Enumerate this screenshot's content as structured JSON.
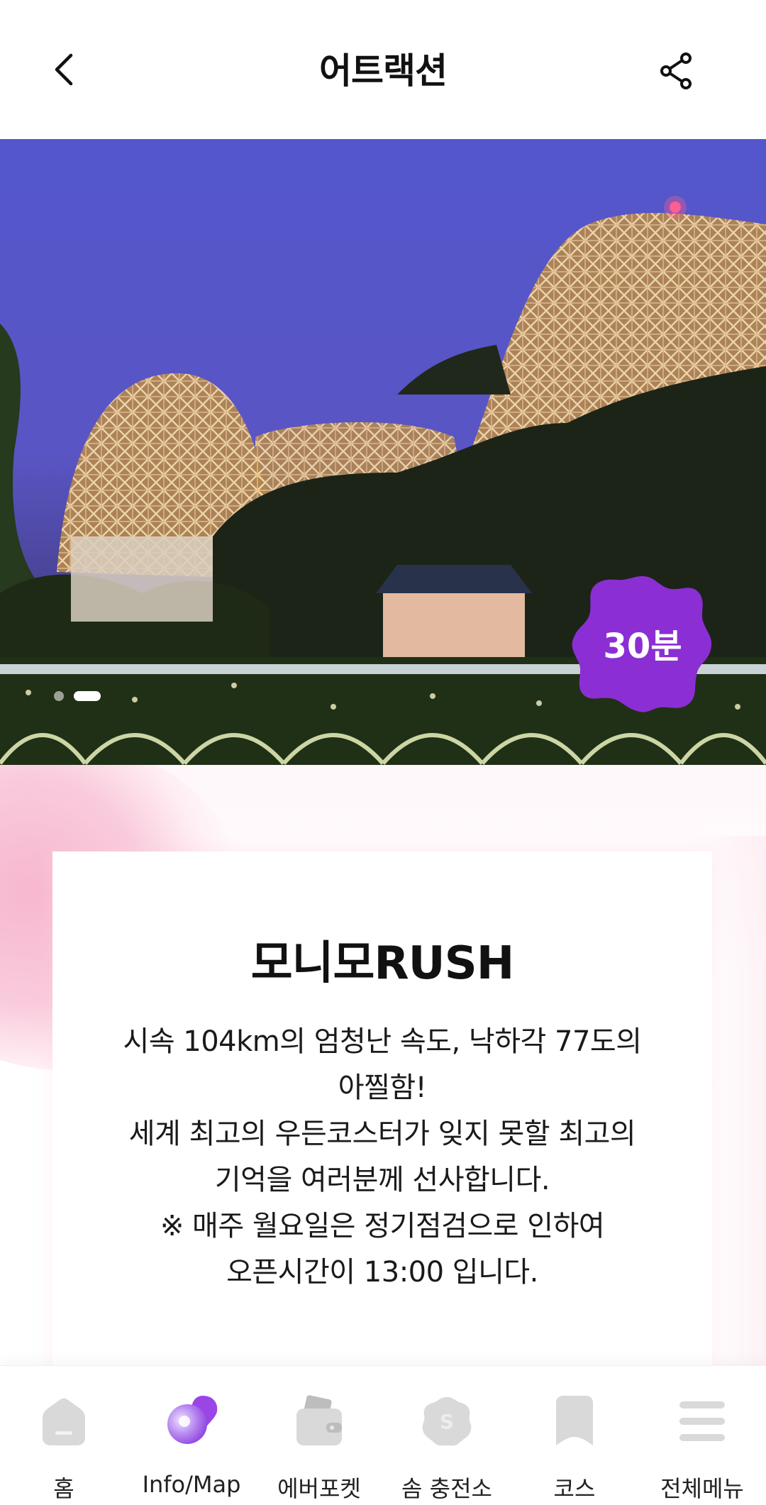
{
  "header": {
    "title": "어트랙션",
    "back_icon": "chevron-left-icon",
    "share_icon": "share-icon"
  },
  "hero": {
    "image_alt": "wooden roller coaster at dusk",
    "badge_text": "30분",
    "badge_color": "#8a2fd3",
    "carousel_total": 2,
    "carousel_active": 2
  },
  "attraction": {
    "name": "모니모RUSH",
    "description": "시속 104km의 엄청난 속도, 낙하각 77도의\n아찔함!\n세계 최고의 우든코스터가 잊지 못할 최고의\n기억을 여러분께 선사합니다.\n※ 매주 월요일은 정기점검으로 인하여\n오픈시간이 13:00 입니다."
  },
  "bottom_nav": {
    "items": [
      {
        "label": "홈",
        "icon": "home-icon"
      },
      {
        "label": "Info/Map",
        "icon": "map-pin-icon",
        "active": true
      },
      {
        "label": "에버포켓",
        "icon": "wallet-icon"
      },
      {
        "label": "솜 충전소",
        "icon": "som-coin-icon"
      },
      {
        "label": "코스",
        "icon": "bookmark-icon"
      },
      {
        "label": "전체메뉴",
        "icon": "menu-icon"
      }
    ],
    "active_color": "#9b4de0"
  }
}
